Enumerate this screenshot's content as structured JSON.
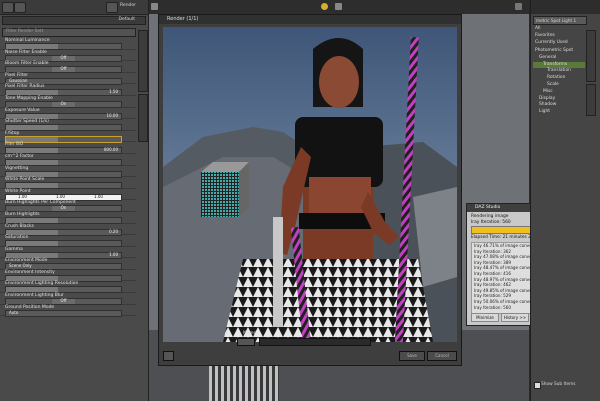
{
  "left_panel": {
    "header_label": "Render",
    "preset_value": "Default",
    "search_placeholder": "Filter Render Sett",
    "settings": [
      {
        "label": "Nominal Luminance",
        "control": "slider",
        "value": ""
      },
      {
        "label": "Noise Filter Enable",
        "control": "toggle",
        "value": "Off"
      },
      {
        "label": "Bloom Filter Enable",
        "control": "toggle",
        "value": "Off"
      },
      {
        "label": "Pixel Filter",
        "control": "dropdown",
        "value": "Gaussian"
      },
      {
        "label": "Pixel Filter Radius",
        "control": "slider",
        "value": "1.50"
      },
      {
        "label": "Tone Mapping Enable",
        "control": "toggle",
        "value": "On"
      },
      {
        "label": "Exposure Value",
        "control": "slider",
        "value": "16.00"
      },
      {
        "label": "Shutter Speed (1/s)",
        "control": "slider",
        "value": ""
      },
      {
        "label": "F/Stop",
        "control": "slider",
        "value": "",
        "highlight": true
      },
      {
        "label": "Film ISO",
        "control": "slider",
        "value": "800.00"
      },
      {
        "label": "cm^2 Factor",
        "control": "slider",
        "value": ""
      },
      {
        "label": "Vignetting",
        "control": "slider",
        "value": ""
      },
      {
        "label": "White Point Scale",
        "control": "slider",
        "value": ""
      },
      {
        "label": "White Point",
        "control": "rgb",
        "values": [
          "1.00",
          "1.00",
          "1.00"
        ]
      },
      {
        "label": "Burn Highlights Per Component",
        "control": "toggle",
        "value": "On"
      },
      {
        "label": "Burn Highlights",
        "control": "slider",
        "value": ""
      },
      {
        "label": "Crush Blacks",
        "control": "slider",
        "value": "0.20"
      },
      {
        "label": "Saturation",
        "control": "slider",
        "value": ""
      },
      {
        "label": "Gamma",
        "control": "slider",
        "value": "1.00"
      },
      {
        "label": "Environment Mode",
        "control": "dropdown",
        "value": "Scene Only"
      },
      {
        "label": "Environment Intensity",
        "control": "slider",
        "value": ""
      },
      {
        "label": "Environment Lighting Resolution",
        "control": "slider",
        "value": ""
      },
      {
        "label": "Environment Lighting Blur",
        "control": "toggle",
        "value": "Off"
      },
      {
        "label": "Ground Position Mode",
        "control": "dropdown",
        "value": "Auto"
      }
    ],
    "side_tabs": [
      "Render Settings",
      "Render Library"
    ]
  },
  "render_window": {
    "title": "Render (1/1)",
    "name_label": "Name",
    "save_label": "Save",
    "cancel_label": "Cancel"
  },
  "progress_dialog": {
    "title": "DAZ Studio",
    "status": "Rendering image",
    "iteration": "Iray Iteration: 560",
    "progress_percent": 96,
    "progress_label": "96%",
    "elapsed": "Elapsed Time:  21 minutes 27 seconds",
    "log": [
      "Iray 46.71% of image converged",
      "Iray Iteration: 362",
      "Iray 47.08% of image converged",
      "Iray Iteration: 389",
      "Iray 48.47% of image converged",
      "Iray Iteration: 416",
      "Iray 48.97% of image converged",
      "Iray Iteration: 462",
      "Iray 49.85% of image converged",
      "Iray Iteration: 529",
      "Iray 50.06% of image converged",
      "Iray Iteration: 560"
    ],
    "minimize_label": "Minimize",
    "history_label": "History >>",
    "cancel_label": "Cancel"
  },
  "right_panel": {
    "search_value": "metric Spot Light 1",
    "filters": [
      "All",
      "Favorites",
      "Currently Used"
    ],
    "tree": [
      {
        "label": "Photometric Spot",
        "indent": 0,
        "selected": false
      },
      {
        "label": "General",
        "indent": 1,
        "selected": false
      },
      {
        "label": "Transforms",
        "indent": 2,
        "selected": true
      },
      {
        "label": "Translation",
        "indent": 3,
        "selected": false
      },
      {
        "label": "Rotation",
        "indent": 3,
        "selected": false
      },
      {
        "label": "Scale",
        "indent": 3,
        "selected": false
      },
      {
        "label": "Misc",
        "indent": 2,
        "selected": false
      },
      {
        "label": "Display",
        "indent": 1,
        "selected": false
      },
      {
        "label": "Shadow",
        "indent": 1,
        "selected": false
      },
      {
        "label": "Light",
        "indent": 1,
        "selected": false
      }
    ],
    "side_tabs": [
      "Parameters",
      "Scene"
    ],
    "show_sub_items_label": "Show Sub Items"
  },
  "colors": {
    "progress_fill": "#f0c020",
    "selected_row": "#5a7a3a",
    "highlight": "#c8a030"
  }
}
